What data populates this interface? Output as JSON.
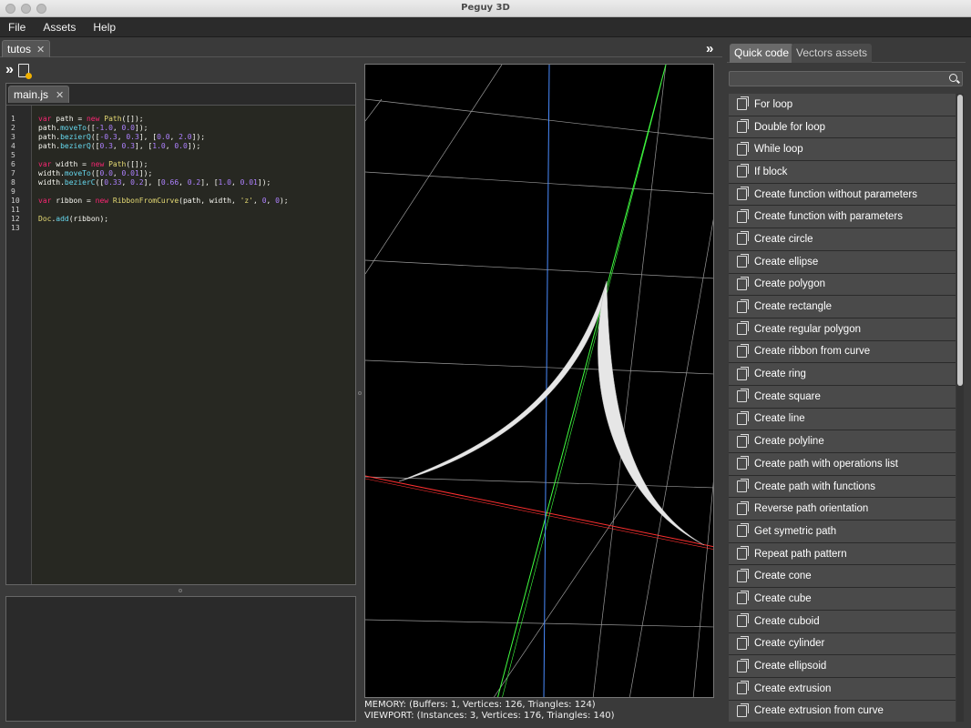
{
  "window": {
    "title": "Peguy 3D"
  },
  "menu": {
    "items": [
      "File",
      "Assets",
      "Help"
    ]
  },
  "left_tab": {
    "label": "tutos",
    "close": "✕"
  },
  "editor": {
    "tab_label": "main.js",
    "tab_close": "✕",
    "line_numbers": [
      "1",
      "2",
      "3",
      "4",
      "5",
      "6",
      "7",
      "8",
      "9",
      "10",
      "11",
      "12",
      "13"
    ]
  },
  "code_lines": [
    [
      [
        "kw",
        "var"
      ],
      [
        "txt",
        " path = "
      ],
      [
        "kw",
        "new"
      ],
      [
        "txt",
        " "
      ],
      [
        "cls",
        "Path"
      ],
      [
        "txt",
        "([]);"
      ]
    ],
    [
      [
        "txt",
        "path."
      ],
      [
        "mth",
        "moveTo"
      ],
      [
        "txt",
        "(["
      ],
      [
        "num",
        "-1.0"
      ],
      [
        "txt",
        ", "
      ],
      [
        "num",
        "0.0"
      ],
      [
        "txt",
        "]);"
      ]
    ],
    [
      [
        "txt",
        "path."
      ],
      [
        "mth",
        "bezierQ"
      ],
      [
        "txt",
        "(["
      ],
      [
        "num",
        "-0.3"
      ],
      [
        "txt",
        ", "
      ],
      [
        "num",
        "0.3"
      ],
      [
        "txt",
        "], ["
      ],
      [
        "num",
        "0.0"
      ],
      [
        "txt",
        ", "
      ],
      [
        "num",
        "2.0"
      ],
      [
        "txt",
        "]);"
      ]
    ],
    [
      [
        "txt",
        "path."
      ],
      [
        "mth",
        "bezierQ"
      ],
      [
        "txt",
        "(["
      ],
      [
        "num",
        "0.3"
      ],
      [
        "txt",
        ", "
      ],
      [
        "num",
        "0.3"
      ],
      [
        "txt",
        "], ["
      ],
      [
        "num",
        "1.0"
      ],
      [
        "txt",
        ", "
      ],
      [
        "num",
        "0.0"
      ],
      [
        "txt",
        "]);"
      ]
    ],
    [],
    [
      [
        "kw",
        "var"
      ],
      [
        "txt",
        " width = "
      ],
      [
        "kw",
        "new"
      ],
      [
        "txt",
        " "
      ],
      [
        "cls",
        "Path"
      ],
      [
        "txt",
        "([]);"
      ]
    ],
    [
      [
        "txt",
        "width."
      ],
      [
        "mth",
        "moveTo"
      ],
      [
        "txt",
        "(["
      ],
      [
        "num",
        "0.0"
      ],
      [
        "txt",
        ", "
      ],
      [
        "num",
        "0.01"
      ],
      [
        "txt",
        "]);"
      ]
    ],
    [
      [
        "txt",
        "width."
      ],
      [
        "mth",
        "bezierC"
      ],
      [
        "txt",
        "(["
      ],
      [
        "num",
        "0.33"
      ],
      [
        "txt",
        ", "
      ],
      [
        "num",
        "0.2"
      ],
      [
        "txt",
        "], ["
      ],
      [
        "num",
        "0.66"
      ],
      [
        "txt",
        ", "
      ],
      [
        "num",
        "0.2"
      ],
      [
        "txt",
        "], ["
      ],
      [
        "num",
        "1.0"
      ],
      [
        "txt",
        ", "
      ],
      [
        "num",
        "0.01"
      ],
      [
        "txt",
        "]);"
      ]
    ],
    [],
    [
      [
        "kw",
        "var"
      ],
      [
        "txt",
        " ribbon = "
      ],
      [
        "kw",
        "new"
      ],
      [
        "txt",
        " "
      ],
      [
        "cls",
        "RibbonFromCurve"
      ],
      [
        "txt",
        "(path, width, "
      ],
      [
        "fn",
        "'z'"
      ],
      [
        "txt",
        ", "
      ],
      [
        "num",
        "0"
      ],
      [
        "txt",
        ", "
      ],
      [
        "num",
        "0"
      ],
      [
        "txt",
        ");"
      ]
    ],
    [],
    [
      [
        "cls",
        "Doc"
      ],
      [
        "txt",
        "."
      ],
      [
        "mth",
        "add"
      ],
      [
        "txt",
        "(ribbon);"
      ]
    ],
    []
  ],
  "status": {
    "memory": "MEMORY: (Buffers: 1, Vertices: 126, Triangles: 124)",
    "viewport": "VIEWPORT: (Instances: 3, Vertices: 176, Triangles: 140)"
  },
  "right_panel": {
    "tabs": [
      "Quick code",
      "Vectors assets"
    ],
    "search": {
      "value": "",
      "placeholder": ""
    },
    "items": [
      "For loop",
      "Double for loop",
      "While loop",
      "If block",
      "Create function without parameters",
      "Create function with parameters",
      "Create circle",
      "Create ellipse",
      "Create polygon",
      "Create rectangle",
      "Create regular polygon",
      "Create ribbon from curve",
      "Create ring",
      "Create square",
      "Create line",
      "Create polyline",
      "Create path with operations list",
      "Create path with functions",
      "Reverse path orientation",
      "Get symetric path",
      "Repeat path pattern",
      "Create cone",
      "Create cube",
      "Create cuboid",
      "Create cylinder",
      "Create ellipsoid",
      "Create extrusion",
      "Create extrusion from curve"
    ]
  },
  "colors": {
    "axis_x": "#ff3030",
    "axis_y": "#40ff40",
    "axis_z": "#4a8cff",
    "grid": "#9a9a9a",
    "ribbon": "#e6e6e6"
  },
  "icons": {
    "run": "double-chevron-right-icon",
    "new_file": "new-file-icon",
    "collapse": "double-chevron-right-icon",
    "search": "search-icon",
    "snippet": "document-copy-icon"
  }
}
